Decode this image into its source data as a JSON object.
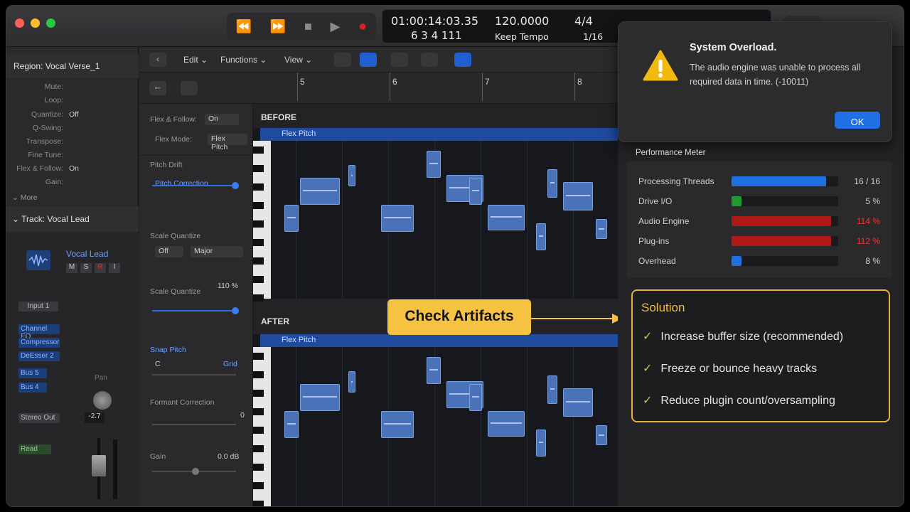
{
  "transport": {
    "rewind": "⏪",
    "forward": "⏩",
    "stop": "■",
    "play": "▶",
    "record": "●"
  },
  "lcd": {
    "time": "01:00:14:03.35",
    "bars": "6 3 4 111",
    "tempo": "120.0000",
    "tempo_mode": "Keep Tempo",
    "signature": "4/4",
    "division": "1/16"
  },
  "inspector": {
    "region_title": "Region: Vocal Verse_1",
    "params": [
      {
        "label": "Mute:",
        "value": ""
      },
      {
        "label": "Loop:",
        "value": ""
      },
      {
        "label": "Quantize:",
        "value": "Off"
      },
      {
        "label": "Q-Swing:",
        "value": ""
      },
      {
        "label": "Transpose:",
        "value": ""
      },
      {
        "label": "Fine Tune:",
        "value": ""
      },
      {
        "label": "Flex & Follow:",
        "value": "On"
      },
      {
        "label": "Gain:",
        "value": ""
      }
    ],
    "more": "More",
    "track_title": "Track: Vocal Lead",
    "track_name": "Vocal Lead",
    "mute": "M",
    "solo": "S",
    "rec": "R",
    "input_mon": "I",
    "input": "Input 1",
    "plugins": [
      "Channel EQ",
      "Compressor",
      "DeEsser 2"
    ],
    "sends": [
      "Bus 5",
      "Bus 4"
    ],
    "output": "Stereo Out",
    "automation": "Read",
    "pan_label": "Pan",
    "volume": "-2.7"
  },
  "toolbar": {
    "edit": "Edit",
    "functions": "Functions",
    "view": "View"
  },
  "ruler": [
    "5",
    "6",
    "7",
    "8"
  ],
  "flex_panel": {
    "flex_follow_label": "Flex & Follow:",
    "flex_follow_value": "On",
    "flex_mode_label": "Flex Mode:",
    "flex_mode_value": "Flex Pitch",
    "pitch_drift_label": "Pitch Drift",
    "pitch_drift_value": "Pitch Correction",
    "scale_quantize_label": "Scale Quantize",
    "scale_off": "Off",
    "scale_major": "Major",
    "scale_quantize2_label": "Scale Quantize",
    "scale_quantize2_value": "110 %",
    "snap_pitch_label": "Snap Pitch",
    "snap_pitch_left": "C",
    "snap_pitch_right": "Grid",
    "formant_label": "Formant Correction",
    "formant_value": "0",
    "gain_label": "Gain",
    "gain_value": "0.0 dB"
  },
  "editor": {
    "before_label": "BEFORE",
    "after_label": "AFTER",
    "before_region": "Flex Pitch",
    "after_region": "Flex Pitch"
  },
  "callout": "Check Artifacts",
  "alert": {
    "title": "System Overload.",
    "message": "The audio engine was unable to process all required data in time. (-10011)",
    "ok": "OK"
  },
  "performance": {
    "title": "Performance Meter",
    "rows": [
      {
        "label": "Processing Threads",
        "value": "16 / 16",
        "fill": 0.95,
        "color": "#1f6fe5",
        "value_color": "#cfcfcf"
      },
      {
        "label": "Drive I/O",
        "value": "5 %",
        "fill": 0.1,
        "color": "#1f9a2f",
        "value_color": "#cfcfcf"
      },
      {
        "label": "Audio Engine",
        "value": "114 %",
        "fill": 1.0,
        "color": "#b01818",
        "value_color": "#e33a3a"
      },
      {
        "label": "Plug-ins",
        "value": "112 %",
        "fill": 1.0,
        "color": "#b01818",
        "value_color": "#e33a3a"
      },
      {
        "label": "Overhead",
        "value": "8 %",
        "fill": 0.1,
        "color": "#1f6fe5",
        "value_color": "#cfcfcf"
      }
    ]
  },
  "solution": {
    "title": "Solution",
    "items": [
      "Increase buffer size (recommended)",
      "Freeze or bounce heavy tracks",
      "Reduce plugin count/oversampling"
    ]
  }
}
